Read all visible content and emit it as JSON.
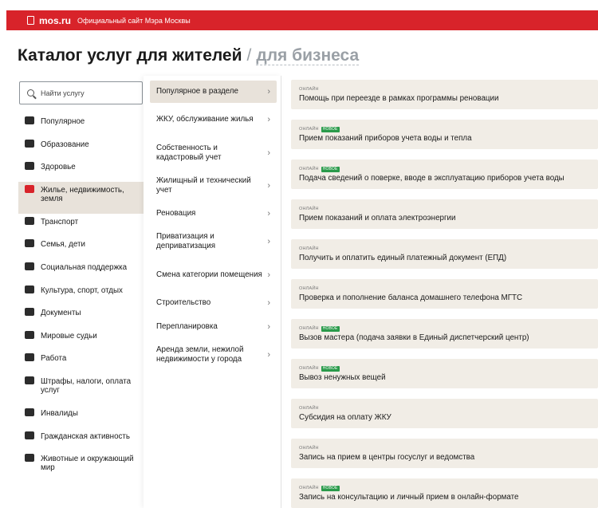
{
  "topbar": {
    "brand": "mos.ru",
    "subtitle": "Официальный сайт Мэра Москвы"
  },
  "heading": {
    "residents": "Каталог услуг для жителей",
    "separator": "/",
    "business": "для бизнеса"
  },
  "search": {
    "placeholder": "Найти услугу"
  },
  "categories": [
    {
      "label": "Популярное",
      "icon": "star-icon"
    },
    {
      "label": "Образование",
      "icon": "graduation-cap-icon"
    },
    {
      "label": "Здоровье",
      "icon": "medical-icon"
    },
    {
      "label": "Жилье, недвижимость, земля",
      "icon": "house-icon",
      "active": true
    },
    {
      "label": "Транспорт",
      "icon": "bus-icon"
    },
    {
      "label": "Семья, дети",
      "icon": "family-icon"
    },
    {
      "label": "Социальная поддержка",
      "icon": "heart-icon"
    },
    {
      "label": "Культура, спорт, отдых",
      "icon": "culture-icon"
    },
    {
      "label": "Документы",
      "icon": "document-icon"
    },
    {
      "label": "Мировые судьи",
      "icon": "judge-icon"
    },
    {
      "label": "Работа",
      "icon": "briefcase-icon"
    },
    {
      "label": "Штрафы, налоги, оплата услуг",
      "icon": "wallet-icon"
    },
    {
      "label": "Инвалиды",
      "icon": "wheelchair-icon"
    },
    {
      "label": "Гражданская активность",
      "icon": "hand-icon"
    },
    {
      "label": "Животные и окружающий мир",
      "icon": "animal-icon"
    }
  ],
  "subcategories": [
    {
      "label": "Популярное в разделе",
      "active": true
    },
    {
      "label": "ЖКУ, обслуживание жилья"
    },
    {
      "label": "Собственность и кадастровый учет"
    },
    {
      "label": "Жилищный и технический учет"
    },
    {
      "label": "Реновация"
    },
    {
      "label": "Приватизация и деприватизация"
    },
    {
      "label": "Смена категории помещения"
    },
    {
      "label": "Строительство"
    },
    {
      "label": "Перепланировка"
    },
    {
      "label": "Аренда земли, нежилой недвижимости у города"
    }
  ],
  "services_meta": {
    "online": "ОНЛАЙН",
    "new": "НОВОЕ"
  },
  "services": [
    {
      "title": "Помощь при переезде в рамках программы реновации",
      "new": false
    },
    {
      "title": "Прием показаний приборов учета воды и тепла",
      "new": true
    },
    {
      "title": "Подача сведений о поверке, вводе в эксплуатацию приборов учета воды",
      "new": true
    },
    {
      "title": "Прием показаний и оплата электроэнергии",
      "new": false
    },
    {
      "title": "Получить и оплатить единый платежный документ (ЕПД)",
      "new": false
    },
    {
      "title": "Проверка и пополнение баланса домашнего телефона МГТС",
      "new": false
    },
    {
      "title": "Вызов мастера (подача заявки в Единый диспетчерский центр)",
      "new": true
    },
    {
      "title": "Вывоз ненужных вещей",
      "new": true
    },
    {
      "title": "Субсидия на оплату ЖКУ",
      "new": false
    },
    {
      "title": "Запись на прием в центры госуслуг и ведомства",
      "new": false
    },
    {
      "title": "Запись на консультацию и личный прием в онлайн-формате",
      "new": true
    }
  ],
  "colors": {
    "brand_red": "#d8232a",
    "active_bg": "#e8e2da",
    "card_bg": "#f1ede6",
    "badge_green": "#2a9a4a"
  }
}
